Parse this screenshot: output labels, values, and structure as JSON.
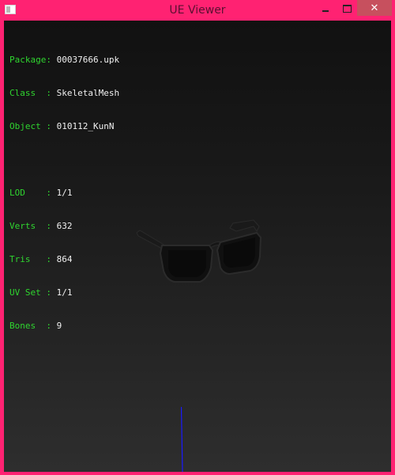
{
  "window": {
    "title": "UE Viewer",
    "controls": {
      "minimize_icon": "minimize-icon",
      "maximize_icon": "maximize-icon",
      "close_icon": "close-icon",
      "close_glyph": "✕"
    },
    "accent_color": "#ff2272"
  },
  "info": {
    "package_label": "Package: ",
    "package_value": "00037666.upk",
    "class_label": "Class  : ",
    "class_value": "SkeletalMesh",
    "object_label": "Object : ",
    "object_value": "010112_KunN",
    "lod_label": "LOD    : ",
    "lod_value": "1/1",
    "verts_label": "Verts  : ",
    "verts_value": "632",
    "tris_label": "Tris   : ",
    "tris_value": "864",
    "uvset_label": "UV Set : ",
    "uvset_value": "1/1",
    "bones_label": "Bones  : ",
    "bones_value": "9"
  },
  "colors": {
    "label": "#2fd52f",
    "value": "#f0f0f0",
    "axis": "#1a1aff"
  }
}
